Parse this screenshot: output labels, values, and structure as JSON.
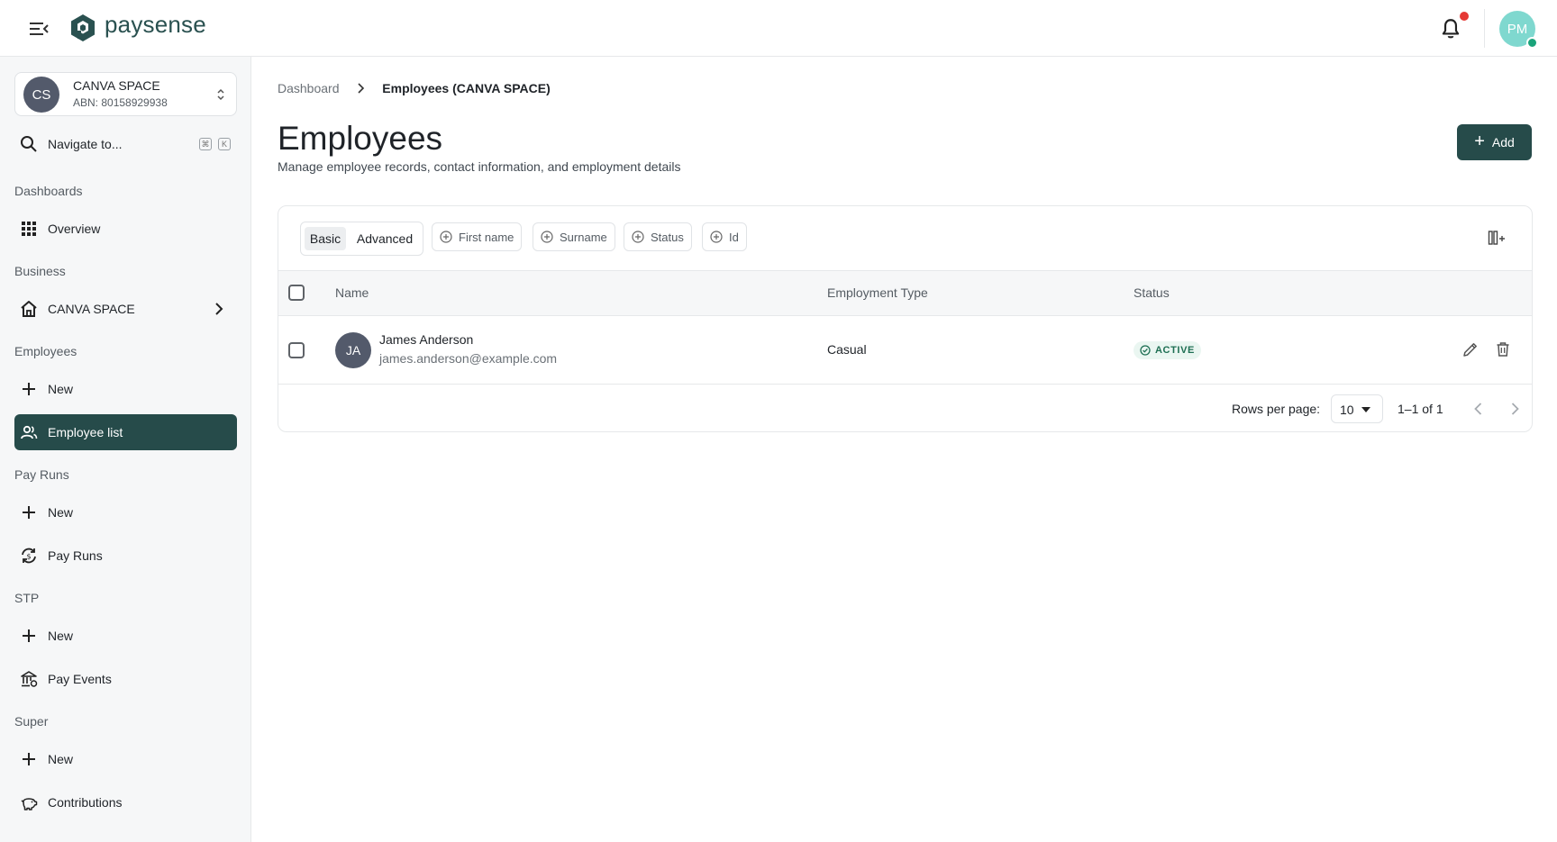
{
  "header": {
    "brand": "paysense",
    "user_initials": "PM",
    "colors": {
      "brand": "#264b4a",
      "notification": "#e53935",
      "avatar": "#7fd8cf"
    }
  },
  "sidebar": {
    "org": {
      "initials": "CS",
      "name": "CANVA SPACE",
      "abn": "ABN: 80158929938"
    },
    "search": {
      "label": "Navigate to...",
      "kbd": [
        "⌘",
        "K"
      ]
    },
    "sections": [
      {
        "title": "Dashboards",
        "items": [
          {
            "label": "Overview",
            "icon": "grid-icon"
          }
        ]
      },
      {
        "title": "Business",
        "items": [
          {
            "label": "CANVA SPACE",
            "icon": "home-icon"
          }
        ]
      },
      {
        "title": "Employees",
        "items": [
          {
            "label": "New",
            "icon": "plus-icon"
          },
          {
            "label": "Employee list",
            "icon": "people-icon",
            "active": true
          }
        ]
      },
      {
        "title": "Pay Runs",
        "items": [
          {
            "label": "New",
            "icon": "plus-icon"
          },
          {
            "label": "Pay Runs",
            "icon": "payrun-cycle-icon"
          }
        ]
      },
      {
        "title": "STP",
        "items": [
          {
            "label": "New",
            "icon": "plus-icon"
          },
          {
            "label": "Pay Events",
            "icon": "bank-icon"
          }
        ]
      },
      {
        "title": "Super",
        "items": [
          {
            "label": "New",
            "icon": "plus-icon"
          },
          {
            "label": "Contributions",
            "icon": "piggy-bank-icon"
          }
        ]
      }
    ]
  },
  "breadcrumb": {
    "root": "Dashboard",
    "current": "Employees (CANVA SPACE)"
  },
  "page": {
    "title": "Employees",
    "subtitle": "Manage employee records, contact information, and employment details",
    "add_label": "Add"
  },
  "filters": {
    "modes": [
      "Basic",
      "Advanced"
    ],
    "active_mode": "Basic",
    "chips": [
      "First name",
      "Surname",
      "Status",
      "Id"
    ]
  },
  "table": {
    "columns": [
      "Name",
      "Employment Type",
      "Status"
    ],
    "rows": [
      {
        "initials": "JA",
        "name": "James Anderson",
        "email": "james.anderson@example.com",
        "employment_type": "Casual",
        "status": "ACTIVE"
      }
    ]
  },
  "pagination": {
    "rows_per_page_label": "Rows per page:",
    "rows_per_page": "10",
    "range": "1–1 of 1"
  }
}
